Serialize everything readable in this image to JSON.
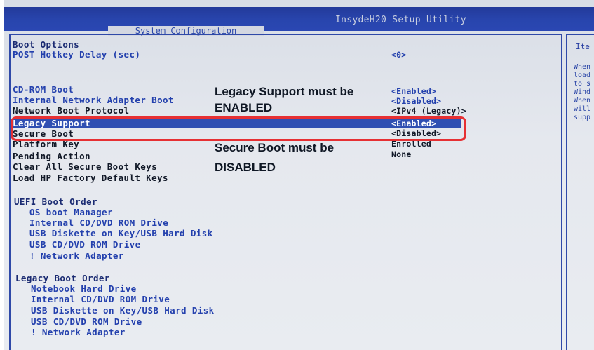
{
  "header": {
    "utility_title": "InsydeH20 Setup Utility",
    "active_tab": "System Configuration"
  },
  "help_panel": {
    "title": "Ite",
    "lines": [
      "When",
      "load",
      "to s",
      "Wind",
      "When",
      "will",
      "supp"
    ]
  },
  "menu": {
    "boot_options": "Boot Options",
    "post_hotkey_delay": {
      "label": "POST Hotkey Delay (sec)",
      "value": "<0>"
    },
    "cdrom_boot": {
      "label": "CD-ROM Boot",
      "value": "<Enabled>"
    },
    "internal_network_adapter_boot": {
      "label": "Internal Network Adapter Boot",
      "value": "<Disabled>"
    },
    "network_boot_protocol": {
      "label": "Network Boot Protocol",
      "value": "<IPv4 (Legacy)>"
    },
    "legacy_support": {
      "label": "Legacy Support",
      "value": "<Enabled>"
    },
    "secure_boot": {
      "label": "Secure Boot",
      "value": "<Disabled>"
    },
    "platform_key": {
      "label": "Platform Key",
      "value": "Enrolled"
    },
    "pending_action": {
      "label": "Pending Action",
      "value": "None"
    },
    "clear_all_secure_boot_keys": {
      "label": "Clear All Secure Boot Keys"
    },
    "load_hp_factory_default_keys": {
      "label": "Load HP Factory Default Keys"
    }
  },
  "uefi_boot_order": {
    "title": "UEFI Boot Order",
    "items": [
      "OS boot Manager",
      "Internal CD/DVD ROM Drive",
      "USB Diskette on Key/USB Hard Disk",
      "USB CD/DVD ROM Drive",
      "! Network Adapter"
    ]
  },
  "legacy_boot_order": {
    "title": "Legacy Boot Order",
    "items": [
      "Notebook Hard Drive",
      "Internal CD/DVD ROM Drive",
      "USB Diskette on Key/USB Hard Disk",
      "USB CD/DVD ROM Drive",
      "! Network Adapter"
    ]
  },
  "annotations": {
    "legacy_line1": "Legacy Support must be",
    "legacy_line2": "ENABLED",
    "secure_line1": "Secure Boot must be",
    "secure_line2": "DISABLED"
  },
  "colors": {
    "bios_blue": "#2340ad",
    "header_blue": "#2845ad",
    "highlight": "#2f4fb2",
    "annotation_red": "#e63033",
    "screen_background": "#e5e8ee"
  },
  "icons": [
    "none"
  ]
}
